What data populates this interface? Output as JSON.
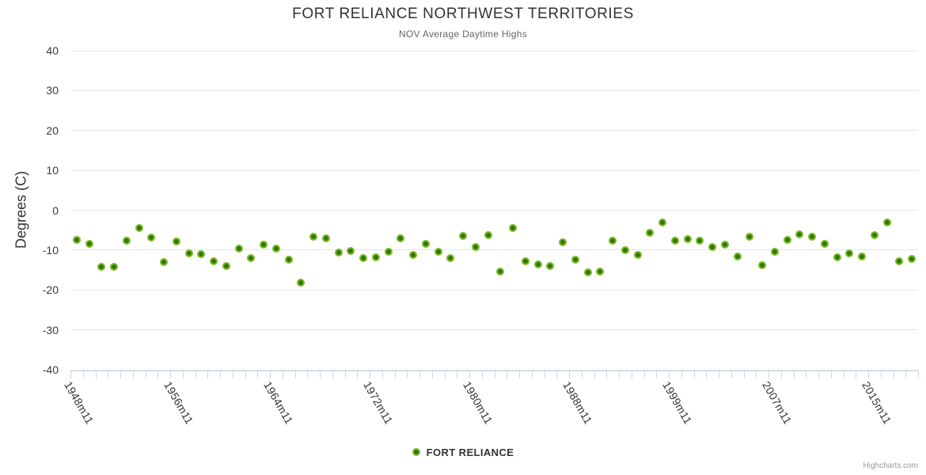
{
  "chart_data": {
    "type": "scatter",
    "title": "FORT RELIANCE NORTHWEST TERRITORIES",
    "subtitle": "NOV Average Daytime Highs",
    "ylabel": "Degrees (C)",
    "ylim": [
      -40,
      40
    ],
    "grid": true,
    "legend_position": "bottom-center",
    "y_ticks": [
      40,
      30,
      20,
      10,
      0,
      -10,
      -20,
      -30,
      -40
    ],
    "x_tick_labels": [
      "1948m11",
      "1956m11",
      "1964m11",
      "1972m11",
      "1980m11",
      "1988m11",
      "1999m11",
      "2007m11",
      "2015m11"
    ],
    "x_tick_label_indices": [
      0,
      8,
      16,
      24,
      32,
      40,
      48,
      56,
      64
    ],
    "num_points": 68,
    "series": [
      {
        "name": "FORT RELIANCE",
        "marker_outer_color": "#76bb21",
        "marker_center_color": "#337208",
        "values": [
          -7.4,
          -8.5,
          -14.2,
          -14.2,
          -7.7,
          -4.4,
          -6.8,
          -13.1,
          -7.8,
          -10.9,
          -11.1,
          -12.9,
          -13.9,
          -9.6,
          -12.1,
          -8.6,
          -9.7,
          -12.5,
          -18.1,
          -6.6,
          -7.1,
          -10.7,
          -10.3,
          -12.0,
          -11.8,
          -10.5,
          -7.0,
          -11.3,
          -8.4,
          -10.4,
          -12.0,
          -6.4,
          -9.2,
          -6.2,
          -15.3,
          -4.5,
          -12.9,
          -13.5,
          -14.0,
          -8.1,
          -12.4,
          -15.5,
          -15.3,
          -7.7,
          -10.0,
          -11.2,
          -5.6,
          -3.0,
          -7.7,
          -7.2,
          -7.7,
          -9.3,
          -8.6,
          -11.7,
          -6.6,
          -13.8,
          -10.5,
          -7.4,
          -6.0,
          -6.7,
          -8.5,
          -11.9,
          -10.9,
          -11.7,
          -6.3,
          -3.1,
          -12.8,
          -12.3
        ]
      }
    ],
    "colors": {
      "grid": "#e6e6e6",
      "axis": "#ccd6eb",
      "title": "#333333",
      "subtitle": "#666666",
      "labels": "#333333",
      "credits": "#999999"
    },
    "credits": "Highcharts.com"
  }
}
